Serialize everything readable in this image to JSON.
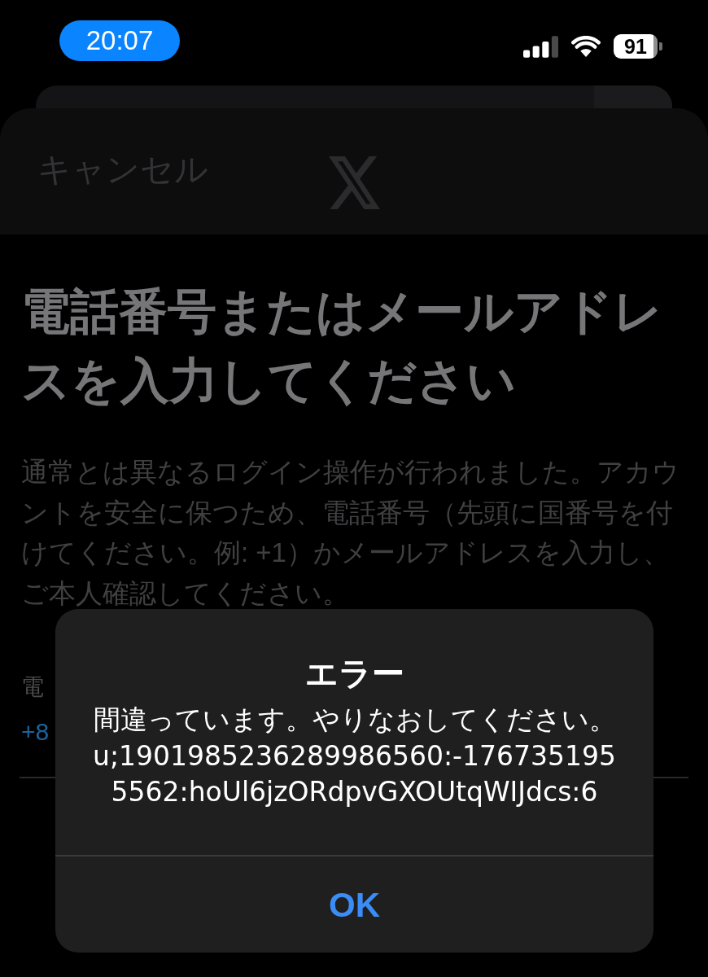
{
  "status_bar": {
    "time": "20:07",
    "battery": "91"
  },
  "sheet": {
    "cancel_label": "キャンセル"
  },
  "page": {
    "title": "電話番号またはメールアドレスを入力してください",
    "description": "通常とは異なるログイン操作が行われました。アカウントを安全に保つため、電話番号（先頭に国番号を付けてください。例: +1）かメールアドレスを入力し、ご本人確認してください。",
    "field": {
      "label": "電",
      "value": "+8"
    }
  },
  "alert": {
    "title": "エラー",
    "message": "間違っています。やりなおしてください。\nu;1901985236289986560:-1767351955562:hoUl6jzORdpvGXOUtqWIJdcs:6",
    "buttons": [
      "OK"
    ]
  }
}
